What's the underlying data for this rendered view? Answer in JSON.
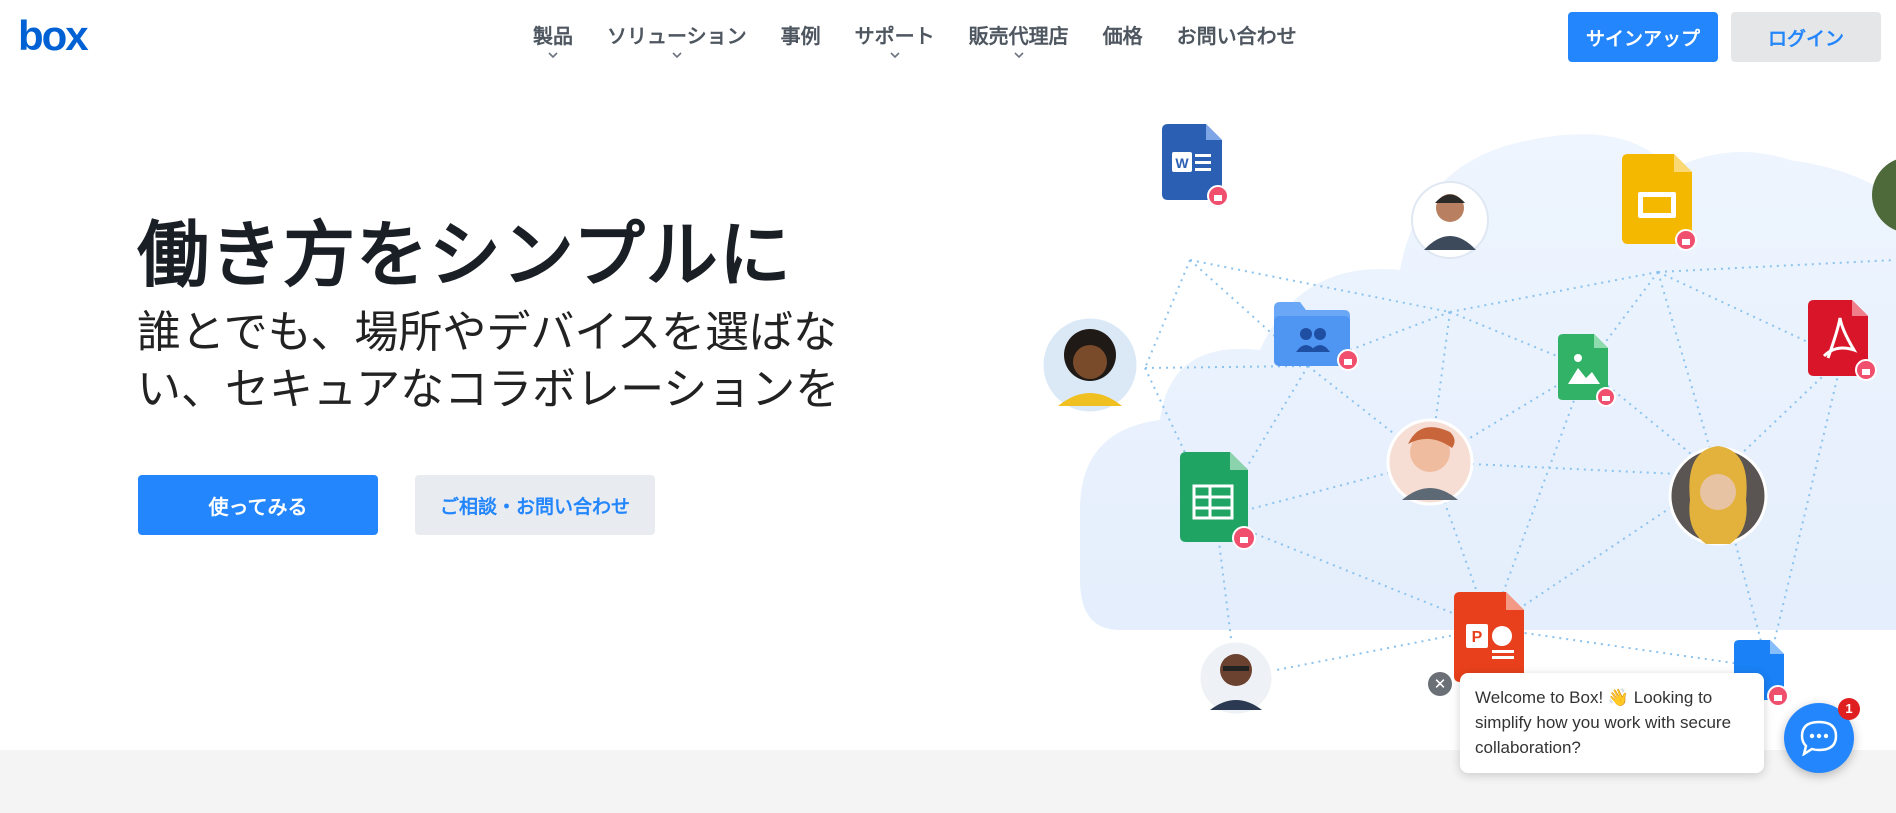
{
  "header": {
    "logo_text": "box",
    "nav": [
      {
        "label": "製品",
        "has_dropdown": true
      },
      {
        "label": "ソリューション",
        "has_dropdown": true
      },
      {
        "label": "事例",
        "has_dropdown": false
      },
      {
        "label": "サポート",
        "has_dropdown": true
      },
      {
        "label": "販売代理店",
        "has_dropdown": true
      },
      {
        "label": "価格",
        "has_dropdown": false
      },
      {
        "label": "お問い合わせ",
        "has_dropdown": false
      }
    ],
    "signup_label": "サインアップ",
    "login_label": "ログイン"
  },
  "hero": {
    "title": "働き方をシンプルに",
    "subtitle": "誰とでも、場所やデバイスを選ばない、セキュアなコラボレーションを",
    "primary_cta": "使ってみる",
    "secondary_cta": "ご相談・お問い合わせ"
  },
  "illustration": {
    "icons": [
      "word-file-icon",
      "google-slides-file-icon",
      "pdf-file-icon",
      "shared-folder-icon",
      "image-file-icon",
      "google-sheets-file-icon",
      "powerpoint-file-icon",
      "blue-file-icon"
    ],
    "avatars": 6
  },
  "chat": {
    "message": "Welcome to Box! 👋 Looking to simplify how you work with secure collaboration?",
    "badge_count": "1"
  },
  "colors": {
    "brand": "#0061d5",
    "accent": "#2486fc",
    "cloud": "#e8f1fd",
    "lock_badge": "#f0506e"
  }
}
